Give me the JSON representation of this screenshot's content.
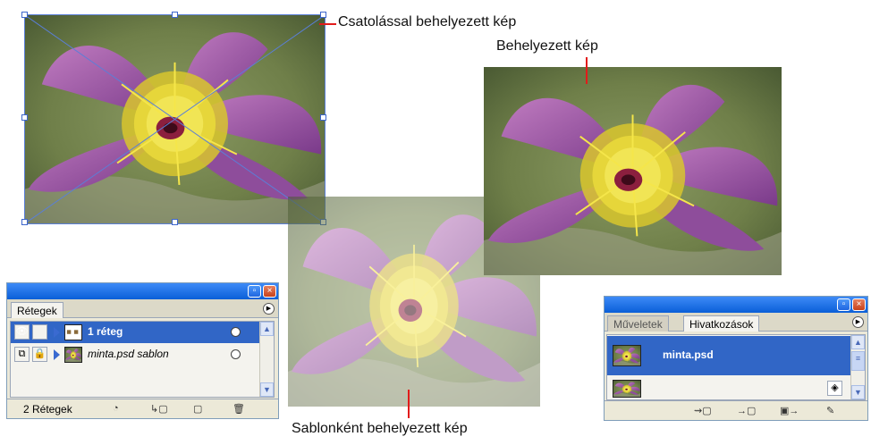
{
  "callouts": {
    "linked": "Csatolással behelyezett kép",
    "placed": "Behelyezett kép",
    "template": "Sablonként behelyezett kép"
  },
  "layers_panel": {
    "tab_label": "Rétegek",
    "layers": [
      {
        "name": "1 réteg",
        "selected": true
      },
      {
        "name": "minta.psd sablon",
        "selected": false
      }
    ],
    "status": "2 Rétegek"
  },
  "links_panel": {
    "tabs": [
      "Műveletek",
      "Hivatkozások"
    ],
    "active_tab": "Hivatkozások",
    "items": [
      {
        "name": "minta.psd",
        "selected": true
      },
      {
        "name": "",
        "selected": false
      }
    ]
  },
  "colors": {
    "accent": "#3166c6",
    "callout_line": "#e21b1b",
    "panel_bg": "#ece9d8"
  }
}
